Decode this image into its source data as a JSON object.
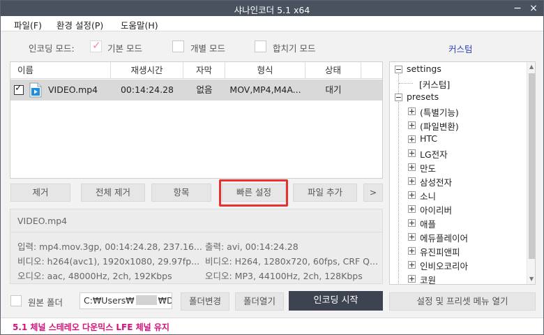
{
  "window": {
    "title": "샤나인코더  5.1  x64",
    "minimize": "−",
    "close": "×"
  },
  "menu": [
    "파일(F)",
    "환경 설정(P)",
    "도움말(H)"
  ],
  "mode_row": {
    "label": "인코딩 모드:",
    "options": [
      {
        "label": "기본 모드",
        "checked": true
      },
      {
        "label": "개별 모드",
        "checked": false
      },
      {
        "label": "합치기 모드",
        "checked": false
      }
    ],
    "custom_link": "커스텀"
  },
  "table": {
    "headers": [
      "이름",
      "재생시간",
      "자막",
      "형식",
      "상태"
    ],
    "rows": [
      {
        "checked": true,
        "name": "VIDEO.mp4",
        "duration": "00:14:24.28",
        "subtitle": "없음",
        "format": "MOV,MP4,M4A...",
        "status": "대기"
      }
    ]
  },
  "actions": [
    "제거",
    "전체 제거",
    "항목",
    "빠른 설정",
    "파일 추가",
    ">"
  ],
  "info": {
    "filename": "VIDEO.mp4",
    "input": "입력:  mp4.mov.3gp, 00:14:24.28, 237.16...",
    "input_video": "비디오:  h264(avc1), 1920x1080, 29.97fp...",
    "input_audio": "오디오:  aac, 48000Hz, 2ch, 192Kbps",
    "output": "출력:  avi, 00:14:24.28",
    "output_video": "비디오:  H264, 1280x720, 60fps, CRF Q...",
    "output_audio": "오디오:  MP3, 44100Hz, 2ch, 128Kbps"
  },
  "tree": {
    "settings": "settings",
    "custom": "[커스텀]",
    "presets": "presets",
    "items": [
      "(특별기능)",
      "(파일변환)",
      "HTC",
      "LG전자",
      "만도",
      "삼성전자",
      "소니",
      "아이리버",
      "애플",
      "에듀플레이어",
      "유진피앤피",
      "인비오코리아",
      "코원"
    ]
  },
  "bottom": {
    "source_folder": "원본 폴더",
    "path_prefix": "C:₩Users₩",
    "path_suffix": "₩Des",
    "change_folder": "폴더변경",
    "open_folder": "폴더열기",
    "start": "인코딩 시작",
    "settings_menu": "설정 및 프리셋 메뉴 열기"
  },
  "status_text": "5.1 체널 스테레오 다운믹스 LFE 체널 유지"
}
